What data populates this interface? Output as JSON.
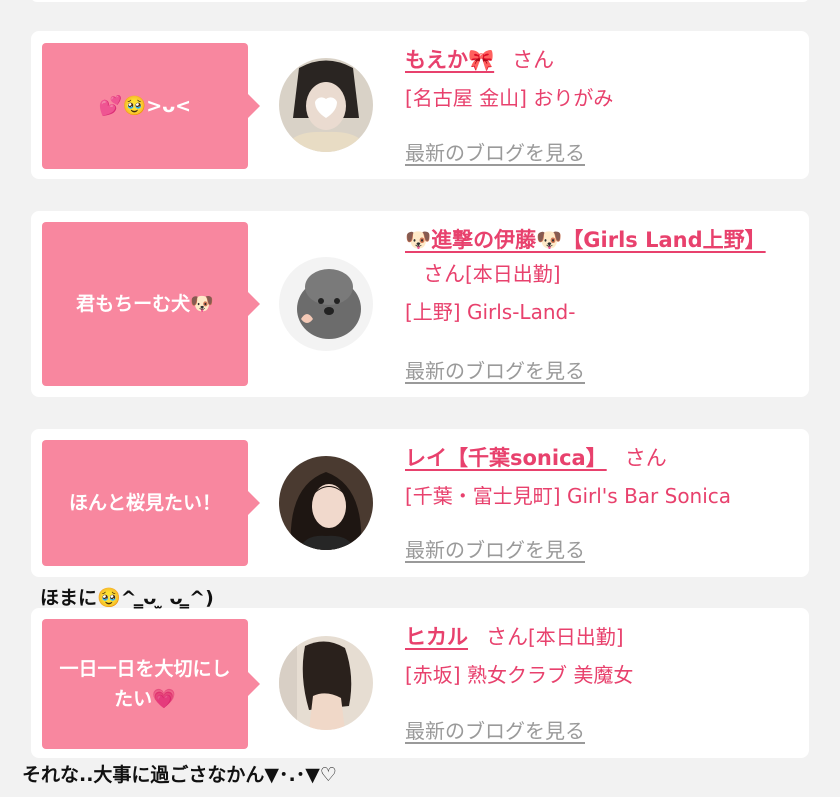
{
  "cards": [
    {
      "bubble_text": "💕🥹>ᴗ<",
      "name": "もえか🎀",
      "san": "さん",
      "status": "",
      "shop": "[名古屋 金山] おりがみ",
      "blog_link": "最新のブログを見る"
    },
    {
      "bubble_text": "君もちーむ犬🐶",
      "name": "🐶進撃の伊藤🐶【Girls Land上野】",
      "san": "さん",
      "status": "[本日出勤]",
      "shop": "[上野] Girls-Land-",
      "blog_link": "最新のブログを見る"
    },
    {
      "bubble_text": "ほんと桜見たい！",
      "name": "レイ【千葉sonica】",
      "san": "さん",
      "status": "",
      "shop": "[千葉・富士見町] Girl's Bar Sonica",
      "blog_link": "最新のブログを見る"
    },
    {
      "bubble_text": "一日一日を大切にしたい💗",
      "name": "ヒカル",
      "san": "さん",
      "status": "[本日出勤]",
      "shop": "[赤坂] 熟女クラブ 美魔女",
      "blog_link": "最新のブログを見る"
    }
  ],
  "overlay_captions": {
    "caption_1": "ほまに🥹^ ̳ᴗ ̫ ᴗ ̳^)",
    "caption_2": "それな..大事に過ごさなかん▼･.･▼♡"
  },
  "colors": {
    "accent_pink": "#f8879f",
    "name_pink": "#e8416d",
    "link_gray": "#9a9a9a"
  }
}
